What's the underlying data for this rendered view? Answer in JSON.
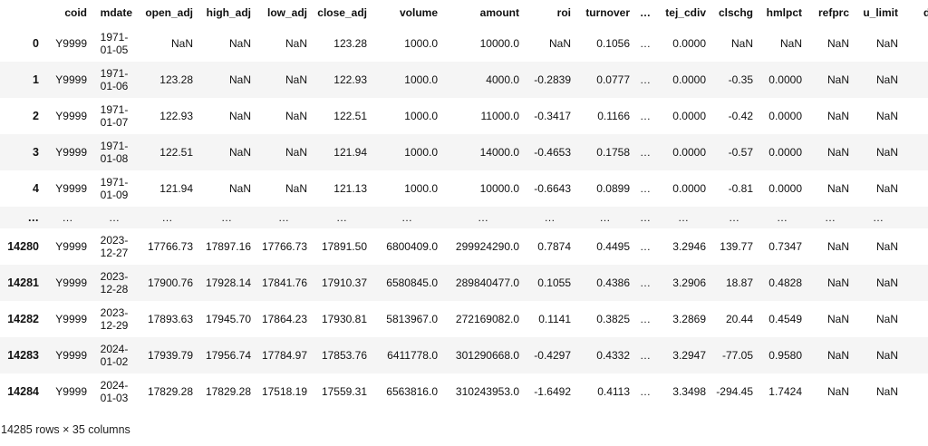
{
  "columns": [
    "coid",
    "mdate",
    "open_adj",
    "high_adj",
    "low_adj",
    "close_adj",
    "volume",
    "amount",
    "roi",
    "turnover",
    "…",
    "tej_cdiv",
    "clschg",
    "hmlpct",
    "refprc",
    "u_limit",
    "d_"
  ],
  "rows": [
    {
      "index": "0",
      "cells": [
        "Y9999",
        [
          "1971-",
          "01-05"
        ],
        "NaN",
        "NaN",
        "NaN",
        "123.28",
        "1000.0",
        "10000.0",
        "NaN",
        "0.1056",
        "…",
        "0.0000",
        "NaN",
        "NaN",
        "NaN",
        "NaN",
        ""
      ]
    },
    {
      "index": "1",
      "cells": [
        "Y9999",
        [
          "1971-",
          "01-06"
        ],
        "123.28",
        "NaN",
        "NaN",
        "122.93",
        "1000.0",
        "4000.0",
        "-0.2839",
        "0.0777",
        "…",
        "0.0000",
        "-0.35",
        "0.0000",
        "NaN",
        "NaN",
        ""
      ]
    },
    {
      "index": "2",
      "cells": [
        "Y9999",
        [
          "1971-",
          "01-07"
        ],
        "122.93",
        "NaN",
        "NaN",
        "122.51",
        "1000.0",
        "11000.0",
        "-0.3417",
        "0.1166",
        "…",
        "0.0000",
        "-0.42",
        "0.0000",
        "NaN",
        "NaN",
        ""
      ]
    },
    {
      "index": "3",
      "cells": [
        "Y9999",
        [
          "1971-",
          "01-08"
        ],
        "122.51",
        "NaN",
        "NaN",
        "121.94",
        "1000.0",
        "14000.0",
        "-0.4653",
        "0.1758",
        "…",
        "0.0000",
        "-0.57",
        "0.0000",
        "NaN",
        "NaN",
        ""
      ]
    },
    {
      "index": "4",
      "cells": [
        "Y9999",
        [
          "1971-",
          "01-09"
        ],
        "121.94",
        "NaN",
        "NaN",
        "121.13",
        "1000.0",
        "10000.0",
        "-0.6643",
        "0.0899",
        "…",
        "0.0000",
        "-0.81",
        "0.0000",
        "NaN",
        "NaN",
        ""
      ]
    },
    {
      "index": "…",
      "ellipsis": true,
      "cells": [
        "…",
        "…",
        "…",
        "…",
        "…",
        "…",
        "…",
        "…",
        "…",
        "…",
        "…",
        "…",
        "…",
        "…",
        "…",
        "…",
        ""
      ]
    },
    {
      "index": "14280",
      "cells": [
        "Y9999",
        [
          "2023-",
          "12-27"
        ],
        "17766.73",
        "17897.16",
        "17766.73",
        "17891.50",
        "6800409.0",
        "299924290.0",
        "0.7874",
        "0.4495",
        "…",
        "3.2946",
        "139.77",
        "0.7347",
        "NaN",
        "NaN",
        ""
      ]
    },
    {
      "index": "14281",
      "cells": [
        "Y9999",
        [
          "2023-",
          "12-28"
        ],
        "17900.76",
        "17928.14",
        "17841.76",
        "17910.37",
        "6580845.0",
        "289840477.0",
        "0.1055",
        "0.4386",
        "…",
        "3.2906",
        "18.87",
        "0.4828",
        "NaN",
        "NaN",
        ""
      ]
    },
    {
      "index": "14282",
      "cells": [
        "Y9999",
        [
          "2023-",
          "12-29"
        ],
        "17893.63",
        "17945.70",
        "17864.23",
        "17930.81",
        "5813967.0",
        "272169082.0",
        "0.1141",
        "0.3825",
        "…",
        "3.2869",
        "20.44",
        "0.4549",
        "NaN",
        "NaN",
        ""
      ]
    },
    {
      "index": "14283",
      "cells": [
        "Y9999",
        [
          "2024-",
          "01-02"
        ],
        "17939.79",
        "17956.74",
        "17784.97",
        "17853.76",
        "6411778.0",
        "301290668.0",
        "-0.4297",
        "0.4332",
        "…",
        "3.2947",
        "-77.05",
        "0.9580",
        "NaN",
        "NaN",
        ""
      ]
    },
    {
      "index": "14284",
      "cells": [
        "Y9999",
        [
          "2024-",
          "01-03"
        ],
        "17829.28",
        "17829.28",
        "17518.19",
        "17559.31",
        "6563816.0",
        "310243953.0",
        "-1.6492",
        "0.4113",
        "…",
        "3.3498",
        "-294.45",
        "1.7424",
        "NaN",
        "NaN",
        ""
      ]
    }
  ],
  "footer": "14285 rows × 35 columns"
}
